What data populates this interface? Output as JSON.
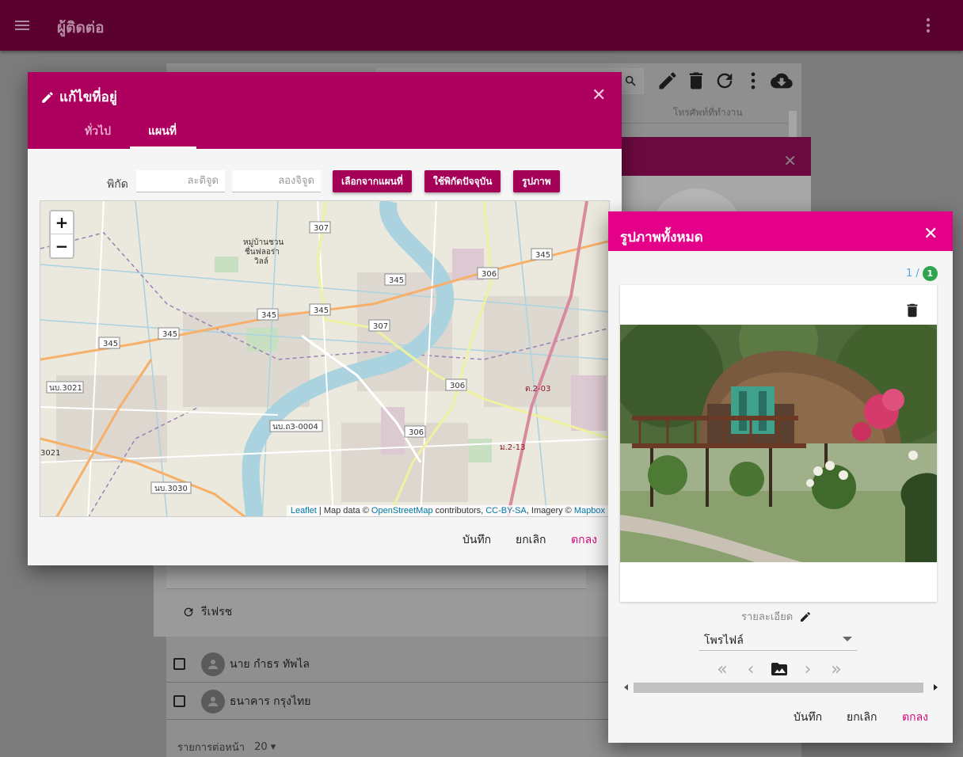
{
  "appbar": {
    "title": "ผู้ติดต่อ"
  },
  "background": {
    "column_header": "โทรศัพท์ที่ทำงาน",
    "refresh_label": "รีเฟรช",
    "rows": [
      {
        "name": "นาย กำธร ทัพไล"
      },
      {
        "name": "ธนาคาร กรุงไทย"
      }
    ],
    "pager_label": "รายการต่อหน้า",
    "pager_value": "20"
  },
  "address_dialog": {
    "title": "แก้ไขที่อยู่",
    "tabs": [
      {
        "label": "ทั่วไป"
      },
      {
        "label": "แผนที่"
      }
    ],
    "active_tab": "แผนที่",
    "coord_label": "พิกัด",
    "lat_placeholder": "ละติจูด",
    "lng_placeholder": "ลองจิจูด",
    "buttons": {
      "pick": "เลือกจากแผนที่",
      "current": "ใช้พิกัดปัจจุบัน",
      "picture": "รูปภาพ"
    },
    "map": {
      "zoom_in": "+",
      "zoom_out": "−",
      "road_labels": [
        "307",
        "307",
        "345",
        "345",
        "345",
        "345",
        "345",
        "345",
        "306",
        "306",
        "306",
        "นบ.3021",
        "นบ.ถ3-0004",
        "นบ.3030",
        "3021",
        "ต.2-03",
        "ม.2-13"
      ],
      "place_labels": [
        "หมู่บ้านชวน",
        "ชื่นฟลอร่า",
        "วิลล์"
      ],
      "attribution": {
        "leaflet": "Leaflet",
        "sep1": " | Map data © ",
        "osm": "OpenStreetMap",
        "sep2": " contributors, ",
        "license": "CC-BY-SA",
        "sep3": ", Imagery © ",
        "provider": "Mapbox"
      }
    },
    "footer": {
      "save": "บันทึก",
      "cancel": "ยกเลิก",
      "ok": "ตกลง"
    }
  },
  "photos_dialog": {
    "title": "รูปภาพทั้งหมด",
    "counter": {
      "current": "1 /",
      "total": "1"
    },
    "description_label": "รายละเอียด",
    "type_value": "โพรไฟล์",
    "footer": {
      "save": "บันทึก",
      "cancel": "ยกเลิก",
      "ok": "ตกลง"
    }
  },
  "colors": {
    "appbar": "#5a0130",
    "dialog_header": "#ad005e",
    "photos_header": "#e5008a",
    "button": "#a40058",
    "ok_text": "#d10678",
    "badge": "#2ea44f"
  }
}
